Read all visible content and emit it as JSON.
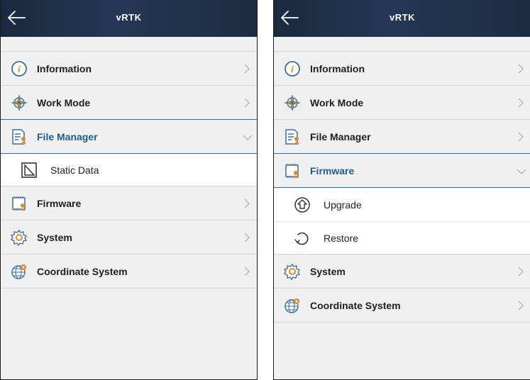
{
  "left": {
    "title": "vRTK",
    "items": [
      {
        "label": "Information",
        "icon": "info-icon"
      },
      {
        "label": "Work Mode",
        "icon": "compass-icon"
      },
      {
        "label": "File Manager",
        "icon": "file-manager-icon",
        "expanded": true
      },
      {
        "label": "Static Data",
        "icon": "static-data-icon",
        "sub": true
      },
      {
        "label": "Firmware",
        "icon": "firmware-icon"
      },
      {
        "label": "System",
        "icon": "gear-icon"
      },
      {
        "label": "Coordinate System",
        "icon": "globe-icon"
      }
    ]
  },
  "right": {
    "title": "vRTK",
    "items": [
      {
        "label": "Information",
        "icon": "info-icon"
      },
      {
        "label": "Work Mode",
        "icon": "compass-icon"
      },
      {
        "label": "File Manager",
        "icon": "file-manager-icon"
      },
      {
        "label": "Firmware",
        "icon": "firmware-icon",
        "expanded": true
      },
      {
        "label": "Upgrade",
        "icon": "upgrade-icon",
        "sub": true
      },
      {
        "label": "Restore",
        "icon": "restore-icon",
        "sub": true
      },
      {
        "label": "System",
        "icon": "gear-icon"
      },
      {
        "label": "Coordinate System",
        "icon": "globe-icon"
      }
    ]
  },
  "colors": {
    "accent": "#1f5a92",
    "topbar": "#1d2c42",
    "icon": "#e08a2a"
  }
}
